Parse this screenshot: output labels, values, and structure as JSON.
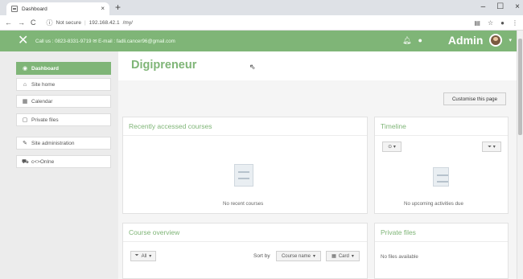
{
  "browser": {
    "tab_title": "Dashboard",
    "tab_close": "×",
    "new_tab": "+",
    "address_security": "Not secure",
    "address_host": "192.168.42.1",
    "address_path": "/my/",
    "window_controls": [
      "–",
      "☐",
      "×"
    ],
    "icons": [
      "back-arrow-icon",
      "forward-arrow-icon",
      "reload-icon",
      "info-icon",
      "translate-icon",
      "star-icon",
      "profile-icon",
      "more-menu-icon"
    ]
  },
  "navbar": {
    "contact_text": "Call us : 0823-8331-9719 ✉ E-mail : fadli.cancer96@gmail.com",
    "user_name": "Admin",
    "accent_color": "#7fb577"
  },
  "sidebar": {
    "items": [
      {
        "label": "Dashboard",
        "icon": "dashboard-icon",
        "active": true
      },
      {
        "label": "Site home",
        "icon": "home-icon",
        "active": false
      },
      {
        "label": "Calendar",
        "icon": "calendar-icon",
        "active": false
      },
      {
        "label": "Private files",
        "icon": "file-icon",
        "active": false
      },
      {
        "label": "Site administration",
        "icon": "wrench-icon",
        "active": false
      },
      {
        "label": "c<>Onlne",
        "icon": "cart-icon",
        "active": false
      }
    ]
  },
  "main": {
    "page_title": "Digipreneur",
    "customise_button": "Customise this page",
    "recent_courses": {
      "title": "Recently accessed courses",
      "empty_text": "No recent courses"
    },
    "timeline": {
      "title": "Timeline",
      "empty_text": "No upcoming activities due",
      "sort_button": "⊙ ▾",
      "filter_button": "⏷ ▾"
    },
    "course_overview": {
      "title": "Course overview",
      "filter_button": "All",
      "sort_by_label": "Sort by",
      "sort_button": "Course name",
      "view_button": "Card"
    },
    "private_files": {
      "title": "Private files",
      "empty_text": "No files available"
    }
  }
}
